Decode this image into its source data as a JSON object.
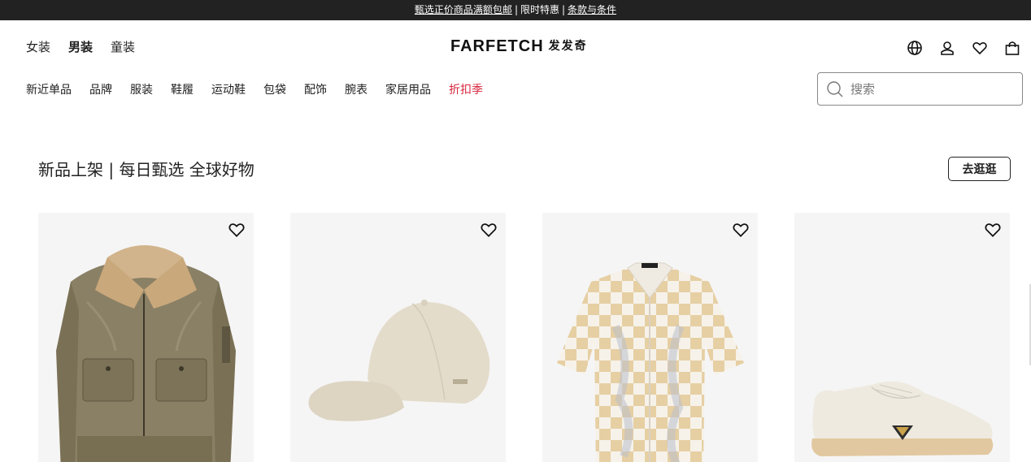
{
  "promo": {
    "link1": "甄选正价商品满额包邮",
    "sep1": "|",
    "text2": "限时特惠",
    "sep2": "|",
    "link3": "条款与条件"
  },
  "gender_nav": [
    "女装",
    "男装",
    "童装"
  ],
  "logo": {
    "brand": "FARFETCH",
    "cn": "发发奇"
  },
  "categories": [
    "新近单品",
    "品牌",
    "服装",
    "鞋履",
    "运动鞋",
    "包袋",
    "配饰",
    "腕表",
    "家居用品",
    "折扣季"
  ],
  "search": {
    "placeholder": "搜索"
  },
  "section": {
    "title": "新品上架 | 每日甄选 全球好物",
    "button": "去逛逛"
  },
  "products": [
    {
      "image": "bomber-jacket"
    },
    {
      "image": "baseball-cap"
    },
    {
      "image": "printed-shirt"
    },
    {
      "image": "white-sneaker"
    }
  ],
  "colors": {
    "sale": "#d7263d",
    "promo_bg": "#222222"
  }
}
